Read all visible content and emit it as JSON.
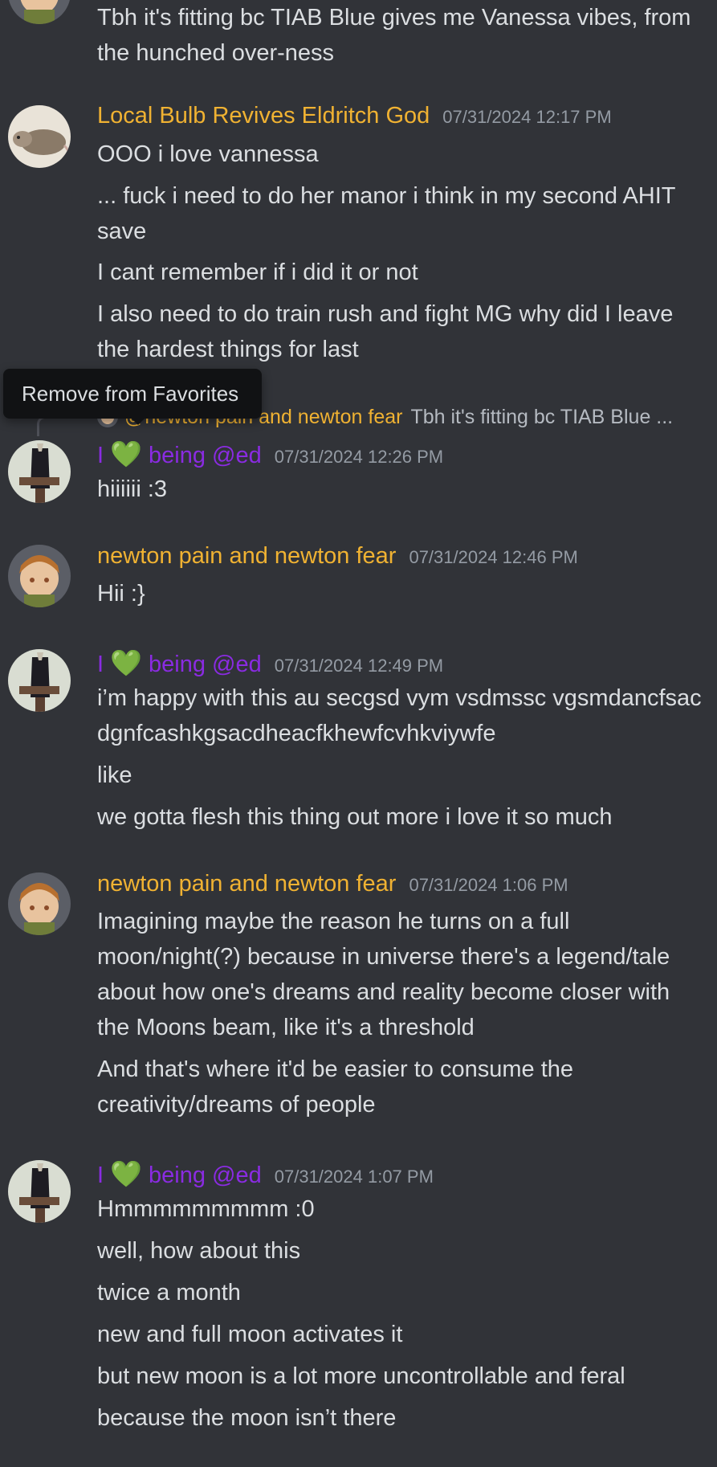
{
  "messages": [
    {
      "lines": [
        "Tbh it's fitting bc TIAB Blue gives me Vanessa vibes, from the hunched over-ness"
      ]
    },
    {
      "author": "Local Bulb Revives Eldritch God",
      "timestamp": "07/31/2024 12:17 PM",
      "lines": [
        "OOO i love vannessa",
        "... fuck i need to do her manor i think in my second AHIT save",
        "I cant remember if i did it or not",
        "I also need to do train rush and fight MG why did I leave the hardest things for last"
      ]
    },
    {
      "reply": {
        "author": "@newton pain and newton fear",
        "text": "Tbh it's fitting bc TIAB Blue ..."
      },
      "author_prefix": "I",
      "author_emoji": "💚",
      "author_suffix": "being @ed",
      "timestamp": "07/31/2024 12:26 PM",
      "lines": [
        "hiiiiii :3"
      ]
    },
    {
      "author": "newton pain and newton fear",
      "timestamp": "07/31/2024 12:46 PM",
      "lines": [
        "Hii :}"
      ]
    },
    {
      "author_prefix": "I",
      "author_emoji": "💚",
      "author_suffix": "being @ed",
      "timestamp": "07/31/2024 12:49 PM",
      "lines": [
        "i’m happy with this au secgsd vym vsdmssc vgsmdancfsacdgnfcashkgsacdheacfkhewfcvhkviywfe",
        "like",
        "we gotta flesh this thing out more i love it so much"
      ]
    },
    {
      "author": "newton pain and newton fear",
      "timestamp": "07/31/2024 1:06 PM",
      "lines": [
        "Imagining maybe the reason he turns on a full moon/night(?) because in universe there's a legend/tale about how one's dreams and reality become closer with the Moons beam, like it's a threshold",
        "And that's where it'd be easier to consume the creativity/dreams of people"
      ]
    },
    {
      "author_prefix": "I",
      "author_emoji": "💚",
      "author_suffix": "being @ed",
      "timestamp": "07/31/2024 1:07 PM",
      "lines": [
        "Hmmmmmmmmm :0",
        "well, how about this",
        "twice a month",
        "new and full moon activates it",
        "but new moon is a lot more uncontrollable and feral",
        "because the moon isn’t there"
      ]
    }
  ],
  "tooltip": "Remove from Favorites",
  "colors": {
    "background": "#313338",
    "text": "#dbdee1",
    "timestamp": "#949ba4",
    "name_yellow": "#f0b232",
    "name_purple": "#8a2be2",
    "heart_green": "#23a55a",
    "tooltip_bg": "#111214"
  }
}
